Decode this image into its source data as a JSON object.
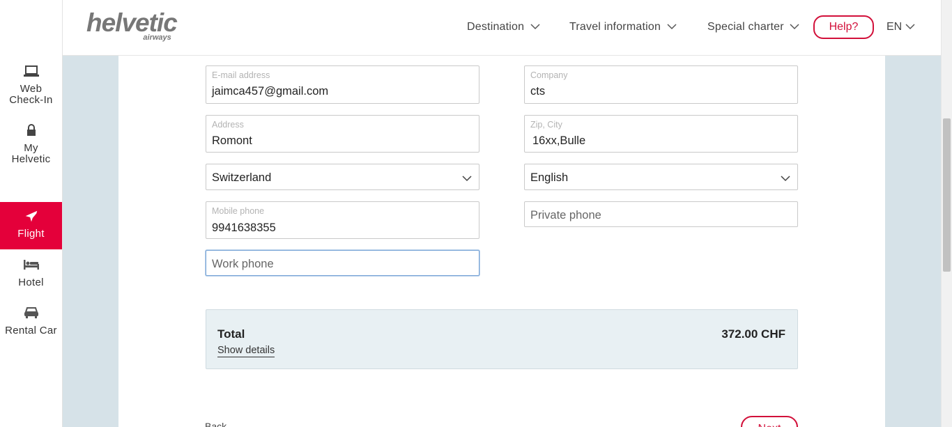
{
  "sidebar": {
    "items": [
      {
        "label_line1": "Web",
        "label_line2": "Check-In",
        "icon": "laptop-icon"
      },
      {
        "label_line1": "My",
        "label_line2": "Helvetic",
        "icon": "lock-icon"
      },
      {
        "label": "Flight",
        "icon": "plane-icon",
        "active": true
      },
      {
        "label": "Hotel",
        "icon": "bed-icon"
      },
      {
        "label": "Rental Car",
        "icon": "car-icon"
      }
    ]
  },
  "header": {
    "logo_word": "helvetic",
    "logo_sub": "airways",
    "nav": [
      "Destination",
      "Travel information",
      "Special charter"
    ],
    "help_label": "Help?",
    "language": "EN"
  },
  "form": {
    "email": {
      "label": "E-mail address",
      "value": "jaimca457@gmail.com"
    },
    "company": {
      "label": "Company",
      "value": "cts"
    },
    "address": {
      "label": "Address",
      "value": "Romont"
    },
    "zip_city": {
      "label": "Zip, City",
      "value": "16xx,Bulle"
    },
    "country": {
      "value": "Switzerland"
    },
    "language": {
      "value": "English"
    },
    "mobile": {
      "label": "Mobile phone",
      "value": "9941638355"
    },
    "private_phone": {
      "placeholder": "Private phone"
    },
    "work_phone": {
      "placeholder": "Work phone"
    }
  },
  "total": {
    "label": "Total",
    "amount": "372.00 CHF",
    "details_link": "Show details"
  },
  "footer": {
    "back_label": "Back",
    "next_label": "Next"
  },
  "colors": {
    "brand_red": "#e4003a",
    "page_bg": "#d6e2e8",
    "total_bg": "#e8f0f3"
  }
}
